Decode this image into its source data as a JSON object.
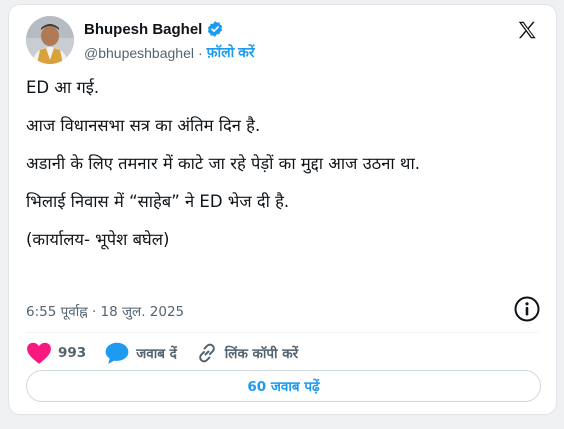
{
  "author": {
    "name": "Bhupesh Baghel",
    "handle": "@bhupeshbaghel",
    "separator": "·",
    "follow_label": "फ़ॉलो करें"
  },
  "tweet": {
    "lines": [
      "ED आ गई.",
      "आज विधानसभा सत्र का अंतिम दिन है.",
      "अडानी के लिए तमनार में काटे जा रहे पेड़ों का मुद्दा आज उठना था.",
      "भिलाई निवास में “साहेब” ने ED भेज दी है.",
      "(कार्यालय- भूपेश बघेल)"
    ],
    "timestamp": "6:55 पूर्वाह्न · 18 जुल. 2025"
  },
  "actions": {
    "like_count": "993",
    "reply_label": "जवाब दें",
    "copy_link_label": "लिंक कॉपी करें"
  },
  "replies_button": "60 जवाब पढ़ें",
  "colors": {
    "accent": "#1d9bf0",
    "like": "#f91880",
    "text": "#0f1419",
    "muted": "#536471"
  }
}
